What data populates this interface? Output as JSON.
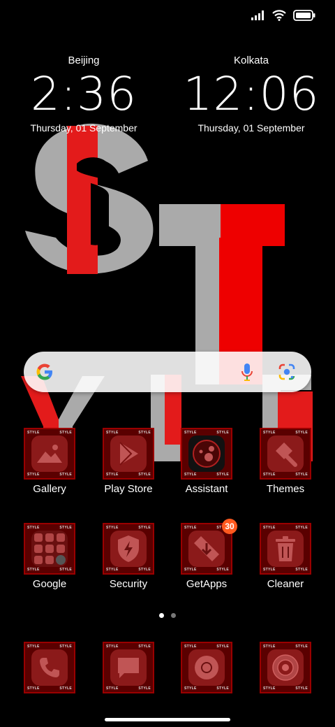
{
  "status_bar": {
    "icons": [
      "signal-icon",
      "wifi-icon",
      "battery-icon"
    ]
  },
  "wallpaper": {
    "colors": {
      "red": "#e31b1b",
      "grey": "#aaaaaa"
    }
  },
  "clocks": [
    {
      "city": "Beijing",
      "time": "2:36",
      "date": "Thursday, 01 September"
    },
    {
      "city": "Kolkata",
      "time": "12:06",
      "date": "Thursday, 01 September"
    }
  ],
  "search_bar": {
    "icons": [
      "google-g-icon",
      "microphone-icon",
      "google-lens-icon"
    ]
  },
  "apps": [
    {
      "label": "Gallery",
      "icon": "gallery-icon"
    },
    {
      "label": "Play Store",
      "icon": "play-store-icon"
    },
    {
      "label": "Assistant",
      "icon": "assistant-icon"
    },
    {
      "label": "Themes",
      "icon": "themes-icon"
    },
    {
      "label": "Google",
      "icon": "google-folder-icon"
    },
    {
      "label": "Security",
      "icon": "security-icon"
    },
    {
      "label": "GetApps",
      "icon": "getapps-icon",
      "badge": "30"
    },
    {
      "label": "Cleaner",
      "icon": "cleaner-icon"
    }
  ],
  "tile_text": {
    "style": "STYLE"
  },
  "page_indicator": {
    "pages": 2,
    "active": 1
  },
  "dock": [
    {
      "icon": "phone-icon"
    },
    {
      "icon": "messages-icon"
    },
    {
      "icon": "chrome-icon"
    },
    {
      "icon": "camera-icon"
    }
  ],
  "colors": {
    "accent": "#ff5a1f",
    "tile": "#5a0000",
    "tile_border": "#9a0000"
  }
}
